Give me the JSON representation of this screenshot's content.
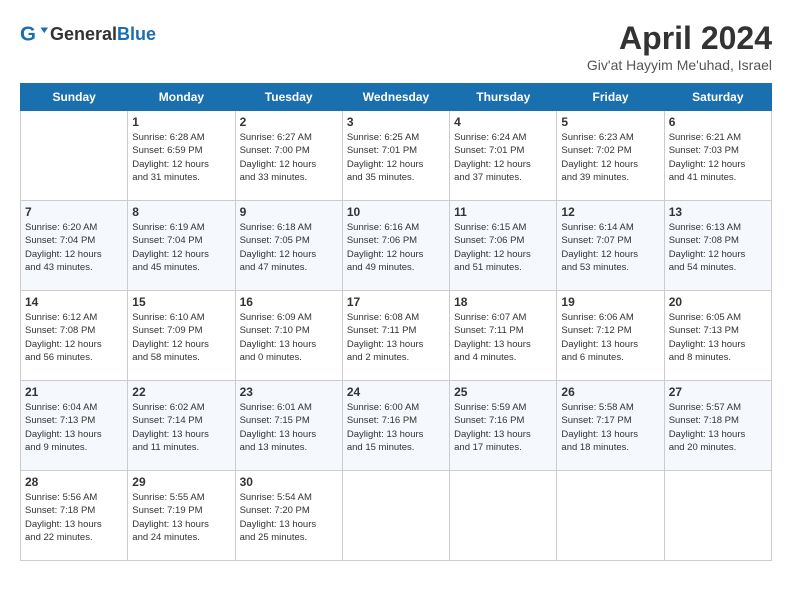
{
  "header": {
    "logo_general": "General",
    "logo_blue": "Blue",
    "title": "April 2024",
    "subtitle": "Giv'at Hayyim Me'uhad, Israel"
  },
  "days_of_week": [
    "Sunday",
    "Monday",
    "Tuesday",
    "Wednesday",
    "Thursday",
    "Friday",
    "Saturday"
  ],
  "weeks": [
    [
      {
        "day": "",
        "info": ""
      },
      {
        "day": "1",
        "info": "Sunrise: 6:28 AM\nSunset: 6:59 PM\nDaylight: 12 hours\nand 31 minutes."
      },
      {
        "day": "2",
        "info": "Sunrise: 6:27 AM\nSunset: 7:00 PM\nDaylight: 12 hours\nand 33 minutes."
      },
      {
        "day": "3",
        "info": "Sunrise: 6:25 AM\nSunset: 7:01 PM\nDaylight: 12 hours\nand 35 minutes."
      },
      {
        "day": "4",
        "info": "Sunrise: 6:24 AM\nSunset: 7:01 PM\nDaylight: 12 hours\nand 37 minutes."
      },
      {
        "day": "5",
        "info": "Sunrise: 6:23 AM\nSunset: 7:02 PM\nDaylight: 12 hours\nand 39 minutes."
      },
      {
        "day": "6",
        "info": "Sunrise: 6:21 AM\nSunset: 7:03 PM\nDaylight: 12 hours\nand 41 minutes."
      }
    ],
    [
      {
        "day": "7",
        "info": "Sunrise: 6:20 AM\nSunset: 7:04 PM\nDaylight: 12 hours\nand 43 minutes."
      },
      {
        "day": "8",
        "info": "Sunrise: 6:19 AM\nSunset: 7:04 PM\nDaylight: 12 hours\nand 45 minutes."
      },
      {
        "day": "9",
        "info": "Sunrise: 6:18 AM\nSunset: 7:05 PM\nDaylight: 12 hours\nand 47 minutes."
      },
      {
        "day": "10",
        "info": "Sunrise: 6:16 AM\nSunset: 7:06 PM\nDaylight: 12 hours\nand 49 minutes."
      },
      {
        "day": "11",
        "info": "Sunrise: 6:15 AM\nSunset: 7:06 PM\nDaylight: 12 hours\nand 51 minutes."
      },
      {
        "day": "12",
        "info": "Sunrise: 6:14 AM\nSunset: 7:07 PM\nDaylight: 12 hours\nand 53 minutes."
      },
      {
        "day": "13",
        "info": "Sunrise: 6:13 AM\nSunset: 7:08 PM\nDaylight: 12 hours\nand 54 minutes."
      }
    ],
    [
      {
        "day": "14",
        "info": "Sunrise: 6:12 AM\nSunset: 7:08 PM\nDaylight: 12 hours\nand 56 minutes."
      },
      {
        "day": "15",
        "info": "Sunrise: 6:10 AM\nSunset: 7:09 PM\nDaylight: 12 hours\nand 58 minutes."
      },
      {
        "day": "16",
        "info": "Sunrise: 6:09 AM\nSunset: 7:10 PM\nDaylight: 13 hours\nand 0 minutes."
      },
      {
        "day": "17",
        "info": "Sunrise: 6:08 AM\nSunset: 7:11 PM\nDaylight: 13 hours\nand 2 minutes."
      },
      {
        "day": "18",
        "info": "Sunrise: 6:07 AM\nSunset: 7:11 PM\nDaylight: 13 hours\nand 4 minutes."
      },
      {
        "day": "19",
        "info": "Sunrise: 6:06 AM\nSunset: 7:12 PM\nDaylight: 13 hours\nand 6 minutes."
      },
      {
        "day": "20",
        "info": "Sunrise: 6:05 AM\nSunset: 7:13 PM\nDaylight: 13 hours\nand 8 minutes."
      }
    ],
    [
      {
        "day": "21",
        "info": "Sunrise: 6:04 AM\nSunset: 7:13 PM\nDaylight: 13 hours\nand 9 minutes."
      },
      {
        "day": "22",
        "info": "Sunrise: 6:02 AM\nSunset: 7:14 PM\nDaylight: 13 hours\nand 11 minutes."
      },
      {
        "day": "23",
        "info": "Sunrise: 6:01 AM\nSunset: 7:15 PM\nDaylight: 13 hours\nand 13 minutes."
      },
      {
        "day": "24",
        "info": "Sunrise: 6:00 AM\nSunset: 7:16 PM\nDaylight: 13 hours\nand 15 minutes."
      },
      {
        "day": "25",
        "info": "Sunrise: 5:59 AM\nSunset: 7:16 PM\nDaylight: 13 hours\nand 17 minutes."
      },
      {
        "day": "26",
        "info": "Sunrise: 5:58 AM\nSunset: 7:17 PM\nDaylight: 13 hours\nand 18 minutes."
      },
      {
        "day": "27",
        "info": "Sunrise: 5:57 AM\nSunset: 7:18 PM\nDaylight: 13 hours\nand 20 minutes."
      }
    ],
    [
      {
        "day": "28",
        "info": "Sunrise: 5:56 AM\nSunset: 7:18 PM\nDaylight: 13 hours\nand 22 minutes."
      },
      {
        "day": "29",
        "info": "Sunrise: 5:55 AM\nSunset: 7:19 PM\nDaylight: 13 hours\nand 24 minutes."
      },
      {
        "day": "30",
        "info": "Sunrise: 5:54 AM\nSunset: 7:20 PM\nDaylight: 13 hours\nand 25 minutes."
      },
      {
        "day": "",
        "info": ""
      },
      {
        "day": "",
        "info": ""
      },
      {
        "day": "",
        "info": ""
      },
      {
        "day": "",
        "info": ""
      }
    ]
  ]
}
